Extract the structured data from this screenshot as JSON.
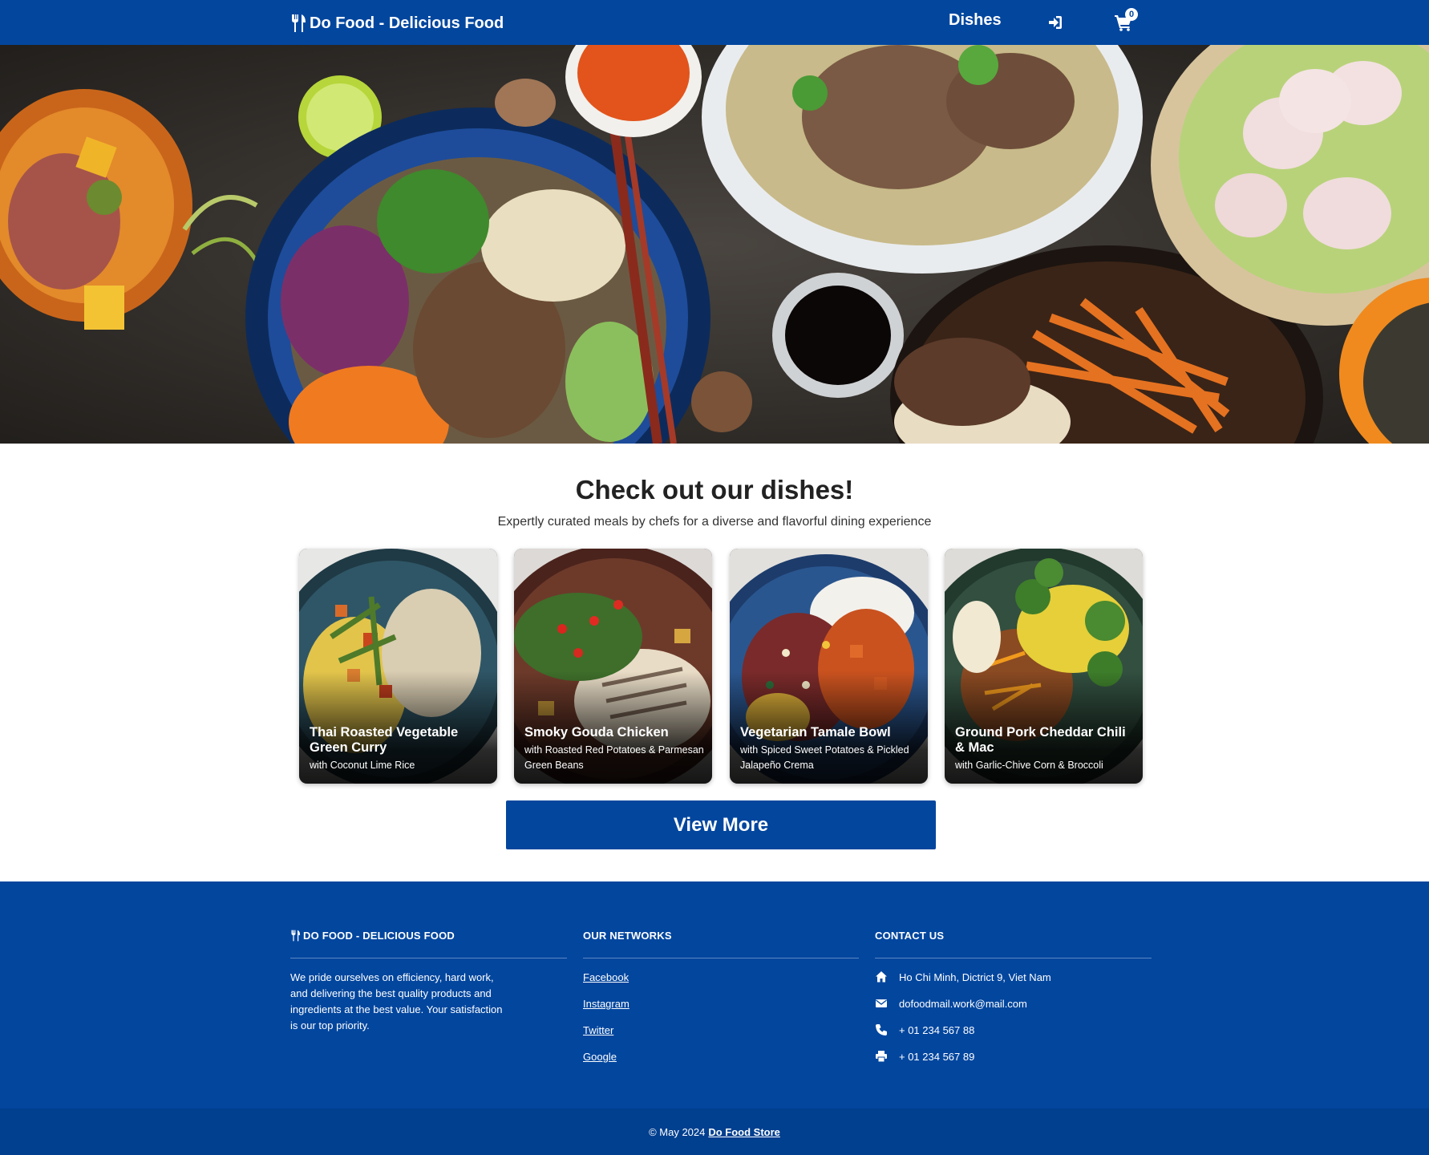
{
  "navbar": {
    "brand": "Do Food - Delicious Food",
    "dishes_link": "Dishes",
    "login_icon": "sign-in-icon",
    "cart_icon": "cart-icon",
    "cart_count": "0",
    "background": "#02469e"
  },
  "hero": {
    "image": "asian-food-table-hero"
  },
  "section": {
    "title": "Check out our dishes!",
    "subtitle": "Expertly curated meals by chefs for a diverse and flavorful dining experience"
  },
  "dishes": [
    {
      "name": "Thai Roasted Vegetable Green Curry",
      "sub": "with Coconut Lime Rice"
    },
    {
      "name": "Smoky Gouda Chicken",
      "sub": "with Roasted Red Potatoes & Parmesan Green Beans"
    },
    {
      "name": "Vegetarian Tamale Bowl",
      "sub": "with Spiced Sweet Potatoes & Pickled Jalapeño Crema"
    },
    {
      "name": "Ground Pork Cheddar Chili & Mac",
      "sub": "with Garlic-Chive Corn & Broccoli"
    }
  ],
  "view_more": "View More",
  "footer": {
    "about_title": "DO FOOD - DELICIOUS FOOD",
    "about_text": "We pride ourselves on efficiency, hard work, and delivering the best quality products and ingredients at the best value. Your satisfaction is our top priority.",
    "networks_title": "OUR NETWORKS",
    "networks": [
      "Facebook",
      "Instagram",
      "Twitter",
      "Google"
    ],
    "contact_title": "CONTACT US",
    "contact": {
      "address": "Ho Chi Minh, Dictrict 9, Viet Nam",
      "email": "dofoodmail.work@mail.com",
      "phone": "+ 01 234 567 88",
      "fax": "+ 01 234 567 89"
    },
    "copyright_prefix": "© May 2024",
    "copyright_link": "Do Food Store"
  }
}
